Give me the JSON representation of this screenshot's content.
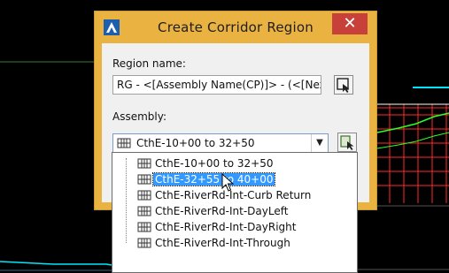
{
  "dialog": {
    "title": "Create Corridor Region",
    "close_label": "✕",
    "region_name_label": "Region name:",
    "region_name_value": "RG - <[Assembly Name(CP)]> - (<[Next Co",
    "assembly_label": "Assembly:",
    "assembly_selected": "CthE-10+00 to 32+50"
  },
  "dropdown": {
    "items": [
      {
        "label": "CthE-10+00 to 32+50",
        "selected": false
      },
      {
        "label": "CthE-32+55 to 40+00",
        "selected": true
      },
      {
        "label": "CthE-RiverRd-Int-Curb Return",
        "selected": false
      },
      {
        "label": "CthE-RiverRd-Int-DayLeft",
        "selected": false
      },
      {
        "label": "CthE-RiverRd-Int-DayRight",
        "selected": false
      },
      {
        "label": "CthE-RiverRd-Int-Through",
        "selected": false
      }
    ]
  },
  "colors": {
    "dialog_frame": "#e9b241",
    "close_button": "#c7403a",
    "selection": "#3399ff",
    "drawing_red": "#ff2a2a",
    "drawing_green": "#2aff2a",
    "drawing_cyan": "#00e5ff"
  },
  "icons": {
    "app": "civil3d-app-icon",
    "pick": "pick-from-drawing-icon",
    "assembly": "assembly-icon"
  }
}
